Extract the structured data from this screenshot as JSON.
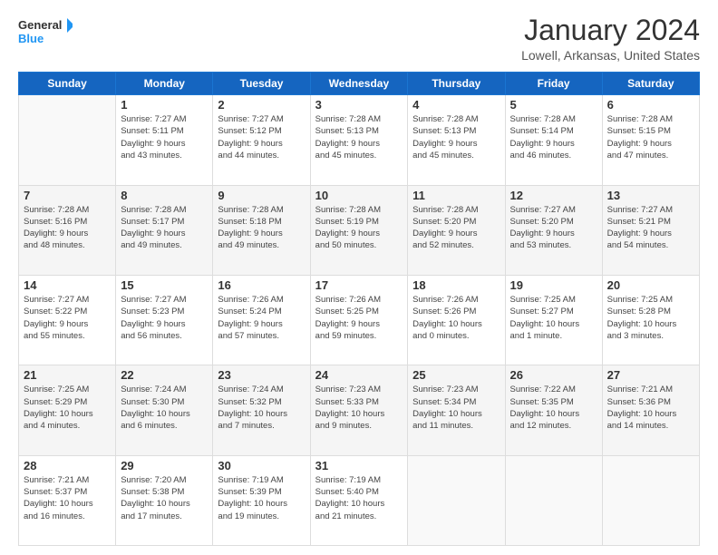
{
  "logo": {
    "text_general": "General",
    "text_blue": "Blue"
  },
  "header": {
    "month_title": "January 2024",
    "location": "Lowell, Arkansas, United States"
  },
  "days_of_week": [
    "Sunday",
    "Monday",
    "Tuesday",
    "Wednesday",
    "Thursday",
    "Friday",
    "Saturday"
  ],
  "weeks": [
    [
      {
        "day": "",
        "info": ""
      },
      {
        "day": "1",
        "info": "Sunrise: 7:27 AM\nSunset: 5:11 PM\nDaylight: 9 hours\nand 43 minutes."
      },
      {
        "day": "2",
        "info": "Sunrise: 7:27 AM\nSunset: 5:12 PM\nDaylight: 9 hours\nand 44 minutes."
      },
      {
        "day": "3",
        "info": "Sunrise: 7:28 AM\nSunset: 5:13 PM\nDaylight: 9 hours\nand 45 minutes."
      },
      {
        "day": "4",
        "info": "Sunrise: 7:28 AM\nSunset: 5:13 PM\nDaylight: 9 hours\nand 45 minutes."
      },
      {
        "day": "5",
        "info": "Sunrise: 7:28 AM\nSunset: 5:14 PM\nDaylight: 9 hours\nand 46 minutes."
      },
      {
        "day": "6",
        "info": "Sunrise: 7:28 AM\nSunset: 5:15 PM\nDaylight: 9 hours\nand 47 minutes."
      }
    ],
    [
      {
        "day": "7",
        "info": "Sunrise: 7:28 AM\nSunset: 5:16 PM\nDaylight: 9 hours\nand 48 minutes."
      },
      {
        "day": "8",
        "info": "Sunrise: 7:28 AM\nSunset: 5:17 PM\nDaylight: 9 hours\nand 49 minutes."
      },
      {
        "day": "9",
        "info": "Sunrise: 7:28 AM\nSunset: 5:18 PM\nDaylight: 9 hours\nand 49 minutes."
      },
      {
        "day": "10",
        "info": "Sunrise: 7:28 AM\nSunset: 5:19 PM\nDaylight: 9 hours\nand 50 minutes."
      },
      {
        "day": "11",
        "info": "Sunrise: 7:28 AM\nSunset: 5:20 PM\nDaylight: 9 hours\nand 52 minutes."
      },
      {
        "day": "12",
        "info": "Sunrise: 7:27 AM\nSunset: 5:20 PM\nDaylight: 9 hours\nand 53 minutes."
      },
      {
        "day": "13",
        "info": "Sunrise: 7:27 AM\nSunset: 5:21 PM\nDaylight: 9 hours\nand 54 minutes."
      }
    ],
    [
      {
        "day": "14",
        "info": "Sunrise: 7:27 AM\nSunset: 5:22 PM\nDaylight: 9 hours\nand 55 minutes."
      },
      {
        "day": "15",
        "info": "Sunrise: 7:27 AM\nSunset: 5:23 PM\nDaylight: 9 hours\nand 56 minutes."
      },
      {
        "day": "16",
        "info": "Sunrise: 7:26 AM\nSunset: 5:24 PM\nDaylight: 9 hours\nand 57 minutes."
      },
      {
        "day": "17",
        "info": "Sunrise: 7:26 AM\nSunset: 5:25 PM\nDaylight: 9 hours\nand 59 minutes."
      },
      {
        "day": "18",
        "info": "Sunrise: 7:26 AM\nSunset: 5:26 PM\nDaylight: 10 hours\nand 0 minutes."
      },
      {
        "day": "19",
        "info": "Sunrise: 7:25 AM\nSunset: 5:27 PM\nDaylight: 10 hours\nand 1 minute."
      },
      {
        "day": "20",
        "info": "Sunrise: 7:25 AM\nSunset: 5:28 PM\nDaylight: 10 hours\nand 3 minutes."
      }
    ],
    [
      {
        "day": "21",
        "info": "Sunrise: 7:25 AM\nSunset: 5:29 PM\nDaylight: 10 hours\nand 4 minutes."
      },
      {
        "day": "22",
        "info": "Sunrise: 7:24 AM\nSunset: 5:30 PM\nDaylight: 10 hours\nand 6 minutes."
      },
      {
        "day": "23",
        "info": "Sunrise: 7:24 AM\nSunset: 5:32 PM\nDaylight: 10 hours\nand 7 minutes."
      },
      {
        "day": "24",
        "info": "Sunrise: 7:23 AM\nSunset: 5:33 PM\nDaylight: 10 hours\nand 9 minutes."
      },
      {
        "day": "25",
        "info": "Sunrise: 7:23 AM\nSunset: 5:34 PM\nDaylight: 10 hours\nand 11 minutes."
      },
      {
        "day": "26",
        "info": "Sunrise: 7:22 AM\nSunset: 5:35 PM\nDaylight: 10 hours\nand 12 minutes."
      },
      {
        "day": "27",
        "info": "Sunrise: 7:21 AM\nSunset: 5:36 PM\nDaylight: 10 hours\nand 14 minutes."
      }
    ],
    [
      {
        "day": "28",
        "info": "Sunrise: 7:21 AM\nSunset: 5:37 PM\nDaylight: 10 hours\nand 16 minutes."
      },
      {
        "day": "29",
        "info": "Sunrise: 7:20 AM\nSunset: 5:38 PM\nDaylight: 10 hours\nand 17 minutes."
      },
      {
        "day": "30",
        "info": "Sunrise: 7:19 AM\nSunset: 5:39 PM\nDaylight: 10 hours\nand 19 minutes."
      },
      {
        "day": "31",
        "info": "Sunrise: 7:19 AM\nSunset: 5:40 PM\nDaylight: 10 hours\nand 21 minutes."
      },
      {
        "day": "",
        "info": ""
      },
      {
        "day": "",
        "info": ""
      },
      {
        "day": "",
        "info": ""
      }
    ]
  ]
}
